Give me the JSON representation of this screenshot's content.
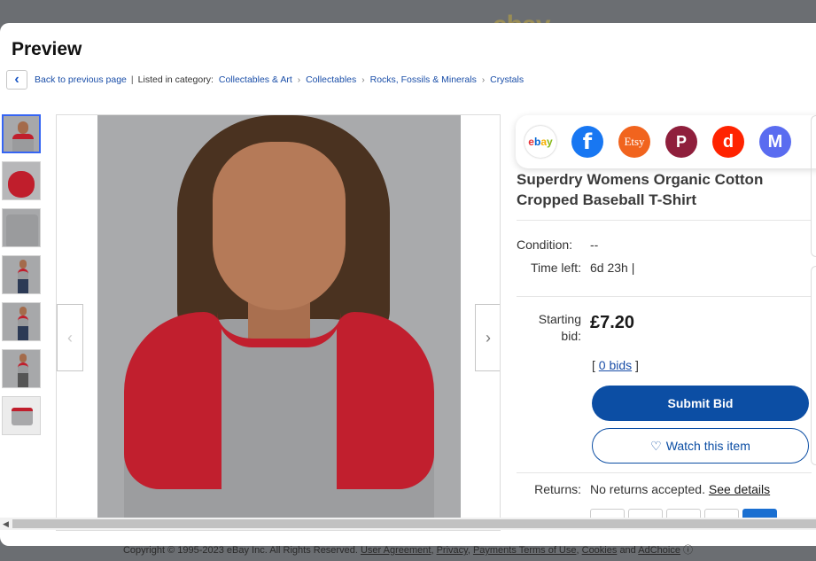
{
  "background": {
    "logo": "ebay",
    "footer": {
      "copyright": "Copyright © 1995-2023 eBay Inc. All Rights Reserved.",
      "links": [
        "User Agreement",
        "Privacy",
        "Payments Terms of Use",
        "Cookies"
      ],
      "and": "and",
      "adchoice": "AdChoice"
    }
  },
  "modal": {
    "title": "Preview",
    "breadcrumb": {
      "back_label": "Back to previous page",
      "listed_in": "Listed in category:",
      "categories": [
        "Collectables & Art",
        "Collectables",
        "Rocks, Fossils & Minerals",
        "Crystals"
      ]
    },
    "share_icons": [
      {
        "name": "ebay-icon",
        "label": "ebay"
      },
      {
        "name": "facebook-icon",
        "label": "f"
      },
      {
        "name": "etsy-icon",
        "label": "Etsy"
      },
      {
        "name": "poshmark-icon",
        "label": "P"
      },
      {
        "name": "depop-icon",
        "label": "d"
      },
      {
        "name": "mercari-icon",
        "label": "M"
      }
    ],
    "item": {
      "title": "Superdry Womens Organic Cotton Cropped Baseball T-Shirt",
      "condition_label": "Condition:",
      "condition_value": "--",
      "time_left_label": "Time left:",
      "time_left_value": "6d 23h |",
      "starting_bid_label": "Starting bid:",
      "price": "£7.20",
      "bids_open": "[",
      "bids_link": "0 bids",
      "bids_close": "]",
      "submit_label": "Submit Bid",
      "watch_label": "Watch this item",
      "returns_label": "Returns:",
      "returns_value": "No returns accepted.",
      "returns_link": "See details"
    },
    "colors": {
      "accent": "#0c4ea4",
      "link": "#1a4ea8",
      "shirt_sleeve": "#c11f2e"
    }
  }
}
